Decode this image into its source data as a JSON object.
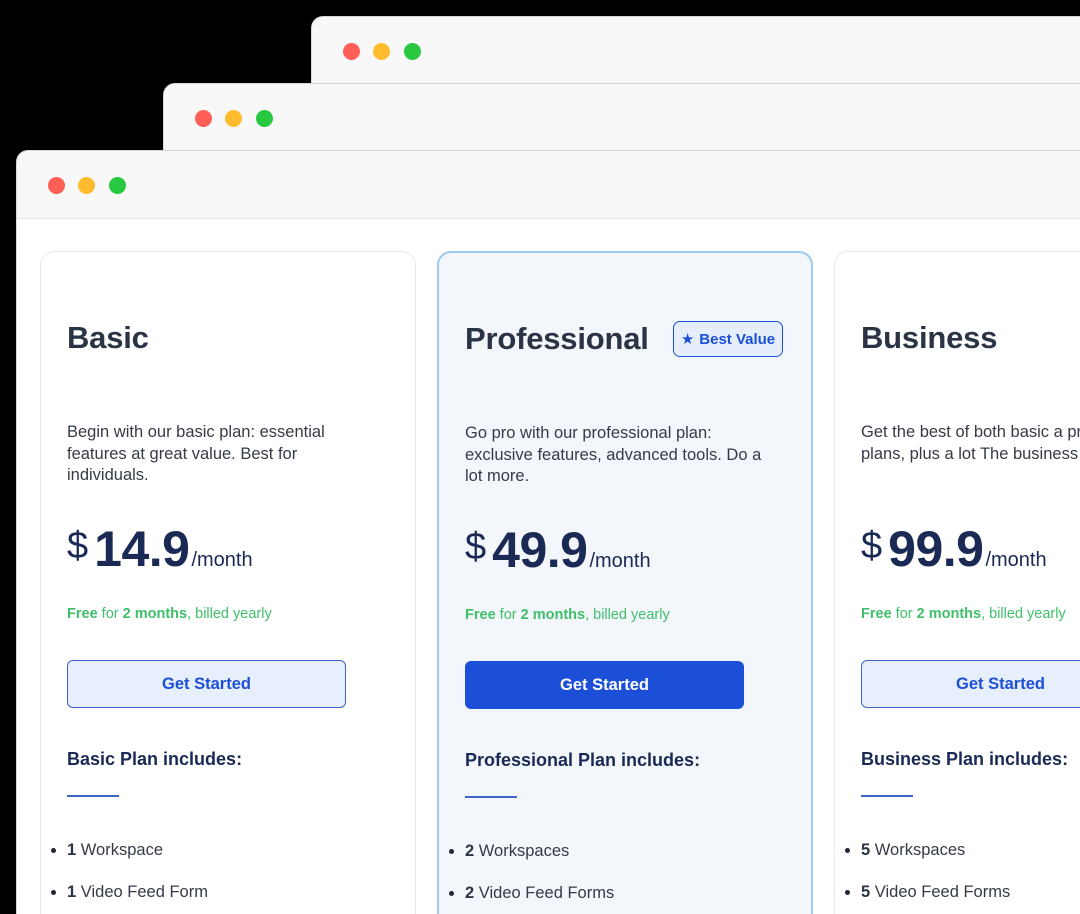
{
  "windows": [
    "back",
    "middle",
    "front"
  ],
  "plans": [
    {
      "id": "basic",
      "name": "Basic",
      "badge": "",
      "description": "Begin with our basic plan: essential features at great value. Best for individuals.",
      "currency": "$",
      "price": "14.9",
      "period": "/month",
      "promo": {
        "free": "Free",
        "for": " for ",
        "months": "2 months",
        "billed": ", billed yearly"
      },
      "cta": "Get Started",
      "includes_title": "Basic Plan includes:",
      "features": [
        {
          "count": "1",
          "label": " Workspace"
        },
        {
          "count": "1",
          "label": " Video Feed Form"
        }
      ]
    },
    {
      "id": "professional",
      "name": "Professional",
      "badge": "Best Value",
      "description": "Go pro with our professional plan: exclusive features, advanced tools. Do a lot more.",
      "currency": "$",
      "price": "49.9",
      "period": "/month",
      "promo": {
        "free": "Free",
        "for": " for ",
        "months": "2 months",
        "billed": ", billed yearly"
      },
      "cta": "Get Started",
      "includes_title": "Professional Plan includes:",
      "features": [
        {
          "count": "2",
          "label": " Workspaces"
        },
        {
          "count": "2",
          "label": " Video Feed Forms"
        }
      ]
    },
    {
      "id": "business",
      "name": "Business",
      "badge": "",
      "description": "Get the best of both basic a professional plans, plus a lot The business plan.",
      "currency": "$",
      "price": "99.9",
      "period": "/month",
      "promo": {
        "free": "Free",
        "for": " for ",
        "months": "2 months",
        "billed": ", billed yearly"
      },
      "cta": "Get Started",
      "includes_title": "Business Plan includes:",
      "features": [
        {
          "count": "5",
          "label": " Workspaces"
        },
        {
          "count": "5",
          "label": " Video Feed Forms"
        }
      ]
    }
  ],
  "icons": {
    "badge_icon": "star-icon"
  },
  "colors": {
    "accent": "#1c4fd8",
    "promo_green": "#3fbf6a",
    "featured_border": "#9ccbee",
    "heading": "#1a2a55"
  }
}
